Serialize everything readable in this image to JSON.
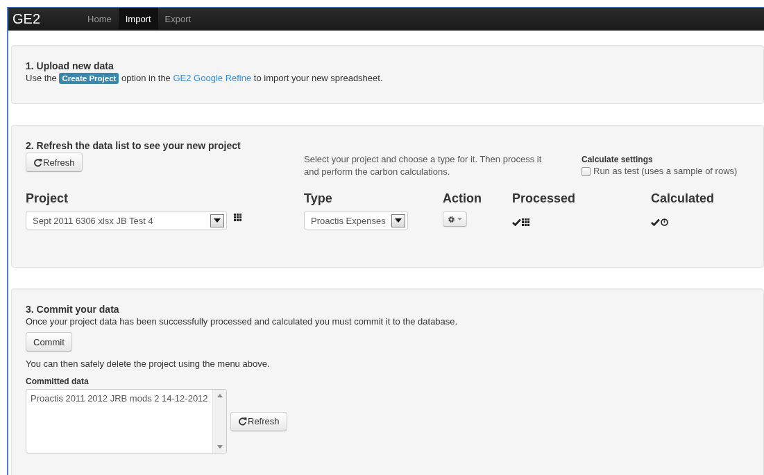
{
  "navbar": {
    "brand": "GE2",
    "tabs": [
      {
        "label": "Home",
        "selected": false
      },
      {
        "label": "Import",
        "selected": true
      },
      {
        "label": "Export",
        "selected": false
      }
    ]
  },
  "upload": {
    "title": "1. Upload new data",
    "text_before": "Use the",
    "badge": "Create Project",
    "text_middle": "option in the",
    "link": "GE2 Google Refine",
    "text_after": "to import your new spreadsheet."
  },
  "refresh": {
    "title": "2. Refresh the data list to see your new project",
    "refresh_button": "Refresh",
    "help": "Select your project and choose a type for it. Then process it and perform the carbon calculations.",
    "settings_title": "Calculate settings",
    "run_as_test": {
      "label": "Run as test (uses a sample of rows)",
      "checked": false
    },
    "columns": [
      "Project",
      "Type",
      "Action",
      "Processed",
      "Calculated"
    ],
    "project": "Sept 2011 6306 xlsx JB Test 4",
    "type": "Proactis Expenses",
    "processed": true,
    "calculated": true
  },
  "commit": {
    "title": "3. Commit your data",
    "text": "Once your project data has been successfully processed and calculated you must commit it to the database.",
    "button": "Commit",
    "note": "You can then safely delete the project using the menu above.",
    "committed_label": "Committed data",
    "committed_items": [
      "Proactis 2011 2012 JRB mods 2 14-12-2012"
    ],
    "refresh_button": "Refresh"
  }
}
